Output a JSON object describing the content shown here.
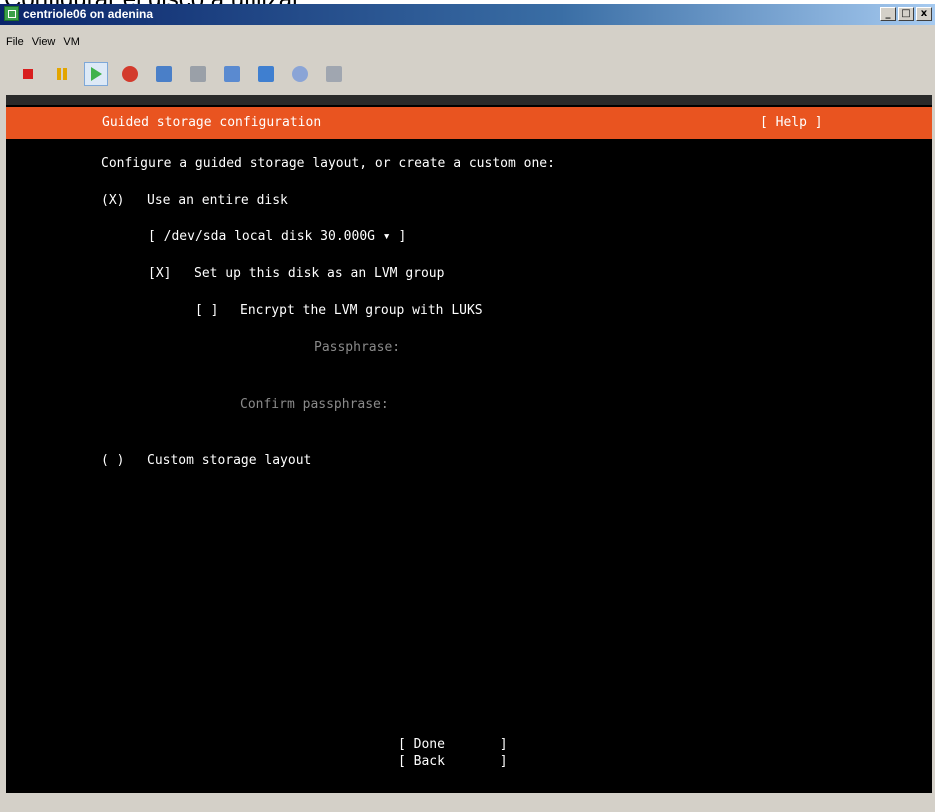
{
  "page_caption": "Configurar el disco a utilizar:",
  "window": {
    "title": "centriole06 on adenina",
    "controls": {
      "minimize": "_",
      "maximize": "□",
      "close": "x"
    }
  },
  "menu": [
    "File",
    "View",
    "VM"
  ],
  "toolbar": [
    {
      "icon": "stop-icon",
      "color": "#d81e1e"
    },
    {
      "icon": "pause-icon",
      "color": "#e3a500"
    },
    {
      "icon": "play-icon",
      "color": "#3fb24a"
    },
    {
      "icon": "reset-icon",
      "color": "#d33a2c"
    },
    {
      "icon": "snapshot-icon",
      "color": "#4a7fc8"
    },
    {
      "icon": "revert-snapshot-icon",
      "color": "#9aa0a8"
    },
    {
      "icon": "manage-snapshots-icon",
      "color": "#5a8ad0"
    },
    {
      "icon": "edit-settings-icon",
      "color": "#3f7fd0"
    },
    {
      "icon": "connect-cd-icon",
      "color": "#8aa4d6"
    },
    {
      "icon": "connect-floppy-icon",
      "color": "#a0a6b0"
    }
  ],
  "installer": {
    "header_title": "Guided storage configuration",
    "help": "[ Help ]",
    "prompt": "Configure a guided storage layout, or create a custom one:",
    "option_entire_disk_mark": "(X)",
    "option_entire_disk_label": "Use an entire disk",
    "disk_select": "[ /dev/sda local disk 30.000G ▾ ]",
    "lvm_mark": "[X]",
    "lvm_label": "Set up this disk as an LVM group",
    "luks_mark": "[ ]",
    "luks_label": "Encrypt the LVM group with LUKS",
    "passphrase_label": "Passphrase:",
    "confirm_label": "Confirm passphrase:",
    "option_custom_mark": "( )",
    "option_custom_label": "Custom storage layout",
    "done_button": "[ Done       ]",
    "back_button": "[ Back       ]"
  },
  "colors": {
    "banner": "#e95420",
    "background": "#000000",
    "text": "#ffffff",
    "dim_text": "#8a8a8a"
  }
}
